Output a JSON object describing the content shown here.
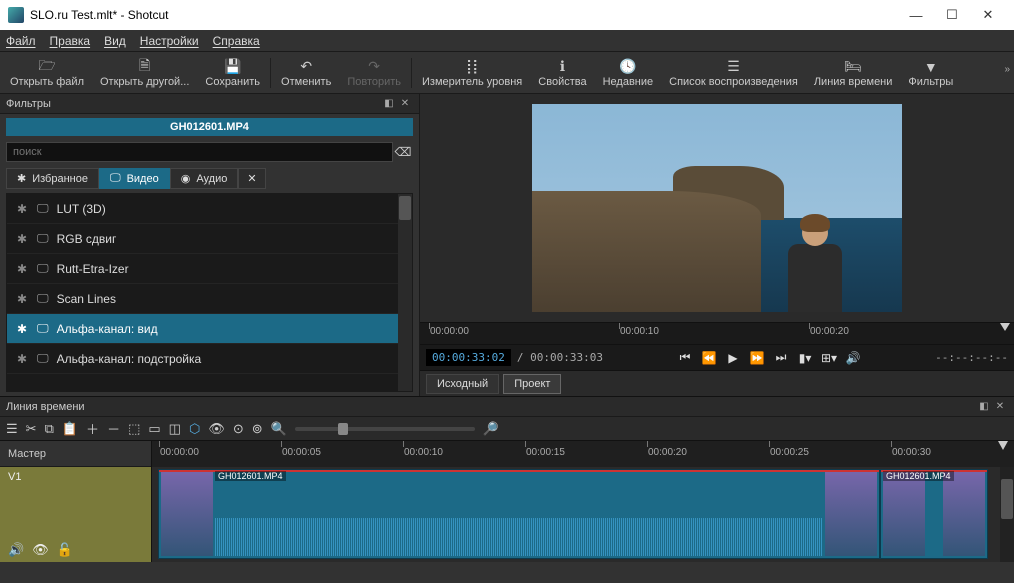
{
  "window": {
    "title": "SLO.ru Test.mlt* - Shotcut"
  },
  "menu": {
    "items": [
      "Файл",
      "Правка",
      "Вид",
      "Настройки",
      "Справка"
    ]
  },
  "toolbar": {
    "open": "Открыть файл",
    "open_other": "Открыть другой...",
    "save": "Сохранить",
    "undo": "Отменить",
    "redo": "Повторить",
    "peak": "Измеритель уровня",
    "props": "Свойства",
    "recent": "Недавние",
    "playlist": "Список воспроизведения",
    "timeline": "Линия времени",
    "filters": "Фильтры"
  },
  "filters_panel": {
    "title": "Фильтры",
    "clip": "GH012601.MP4",
    "search_placeholder": "поиск",
    "tabs": {
      "fav": "Избранное",
      "video": "Видео",
      "audio": "Аудио"
    },
    "items": [
      {
        "label": "LUT (3D)"
      },
      {
        "label": "RGB сдвиг"
      },
      {
        "label": "Rutt-Etra-Izer"
      },
      {
        "label": "Scan Lines"
      },
      {
        "label": "Альфа-канал: вид",
        "selected": true
      },
      {
        "label": "Альфа-канал: подстройка"
      }
    ]
  },
  "player": {
    "ruler": [
      "00:00:00",
      "00:00:10",
      "00:00:20"
    ],
    "current": "00:00:33:02",
    "duration": "/ 00:00:33:03",
    "end": "--:--:--:--",
    "source": "Исходный",
    "project": "Проект"
  },
  "timeline": {
    "title": "Линия времени",
    "master": "Мастер",
    "track": "V1",
    "ruler": [
      "00:00:00",
      "00:00:05",
      "00:00:10",
      "00:00:15",
      "00:00:20",
      "00:00:25",
      "00:00:30"
    ],
    "clips": [
      {
        "label": "GH012601.MP4"
      },
      {
        "label": "GH012601.MP4"
      }
    ]
  }
}
